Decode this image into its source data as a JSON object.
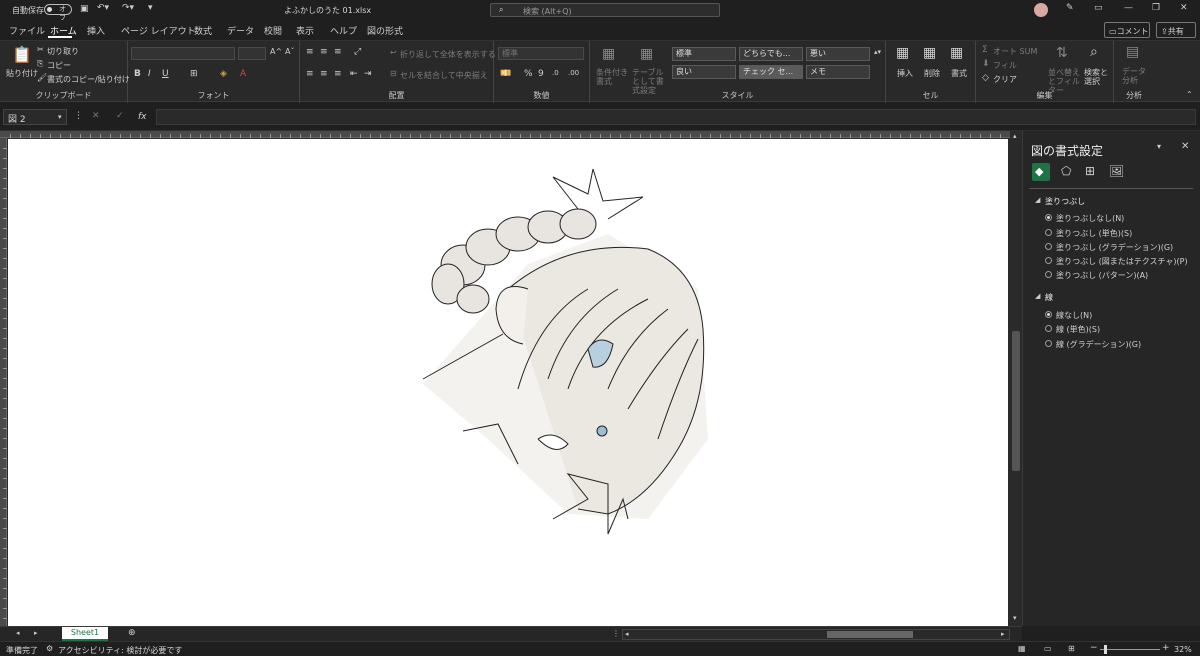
{
  "titlebar": {
    "autosave_label": "自動保存",
    "autosave_state": "オフ",
    "file_name": "よふかしのうた 01.xlsx",
    "search_placeholder": "検索 (Alt+Q)"
  },
  "ribbon_tabs": [
    "ファイル",
    "ホーム",
    "挿入",
    "ページ レイアウト",
    "数式",
    "データ",
    "校閲",
    "表示",
    "ヘルプ",
    "図の形式"
  ],
  "active_tab": "ホーム",
  "header_buttons": {
    "comment": "コメント",
    "share": "共有"
  },
  "ribbon": {
    "clipboard": {
      "paste": "貼り付け",
      "cut": "切り取り",
      "copy": "コピー",
      "format_painter": "書式のコピー/貼り付け",
      "group": "クリップボード"
    },
    "font": {
      "group": "フォント"
    },
    "alignment": {
      "wrap": "折り返して全体を表示する",
      "merge": "セルを結合して中央揃え",
      "group": "配置"
    },
    "number": {
      "format": "標準",
      "group": "数値"
    },
    "styles": {
      "cond_format": "条件付き書式",
      "table_format": "テーブルとして書式設定",
      "cells": [
        "標準",
        "どちらでも...",
        "悪い",
        "良い",
        "チェック セ...",
        "メモ"
      ],
      "group": "スタイル"
    },
    "cells": {
      "insert": "挿入",
      "delete": "削除",
      "format": "書式",
      "group": "セル"
    },
    "editing": {
      "autosum": "オート SUM",
      "fill": "フィル",
      "clear": "クリア",
      "sort": "並べ替えとフィルター",
      "find": "検索と選択",
      "group": "編集"
    },
    "analysis": {
      "data_analysis": "データ分析",
      "group": "分析"
    }
  },
  "formula_bar": {
    "name_box": "図 2",
    "fx": "fx"
  },
  "format_pane": {
    "title": "図の書式設定",
    "fill_section": "塗りつぶし",
    "fill_options": [
      "塗りつぶしなし(N)",
      "塗りつぶし (単色)(S)",
      "塗りつぶし (グラデーション)(G)",
      "塗りつぶし (図またはテクスチャ)(P)",
      "塗りつぶし (パターン)(A)"
    ],
    "line_section": "線",
    "line_options": [
      "線なし(N)",
      "線 (単色)(S)",
      "線 (グラデーション)(G)"
    ]
  },
  "sheet_tab": "Sheet1",
  "status": {
    "ready": "準備完了",
    "accessibility": "アクセシビリティ: 検討が必要です",
    "zoom": "32%"
  },
  "colors": {
    "accent_green": "#217346",
    "bg": "#1f1f1f",
    "ribbon": "#292929"
  }
}
